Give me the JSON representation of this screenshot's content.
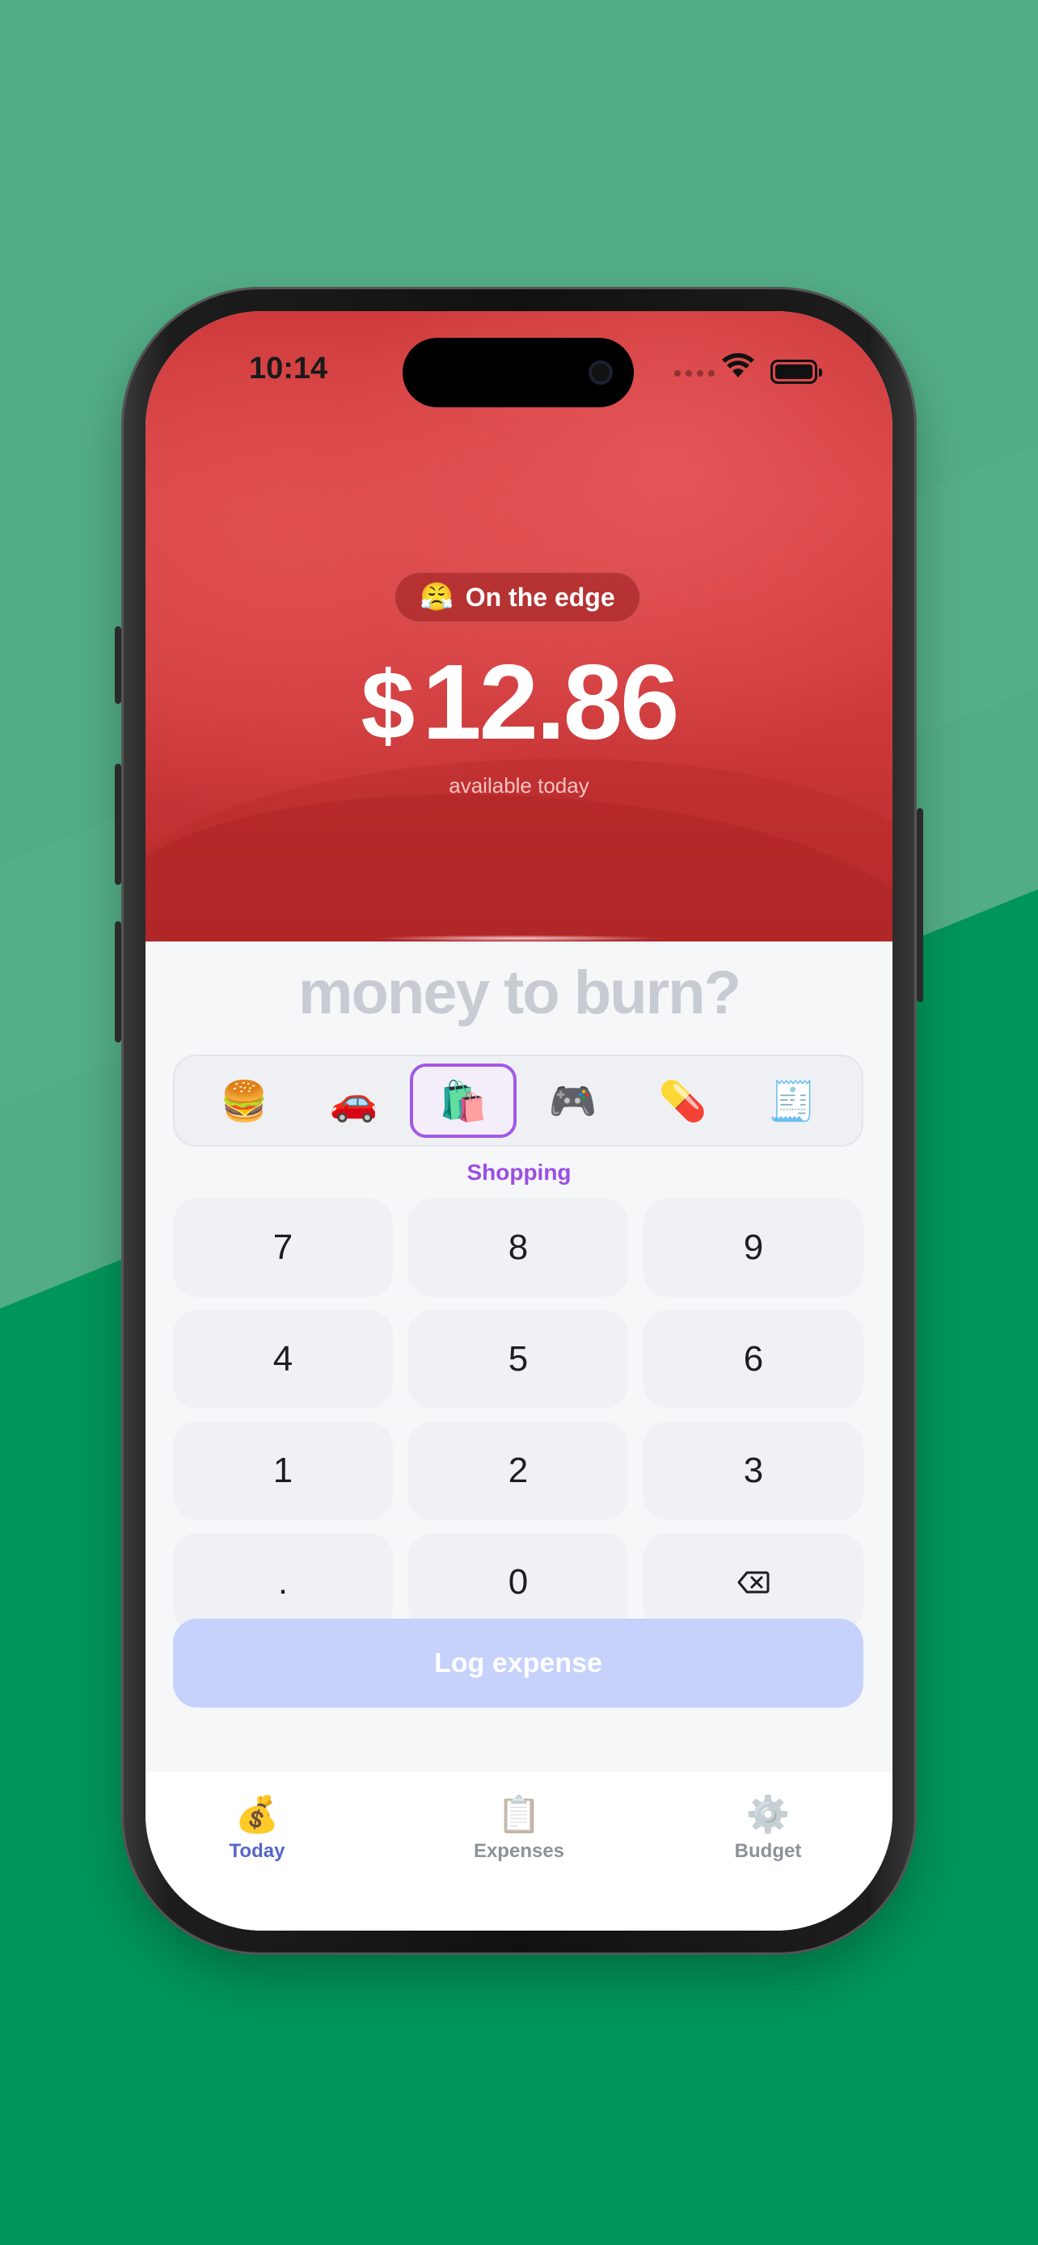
{
  "status_bar": {
    "time": "10:14"
  },
  "header": {
    "mood_emoji": "😤",
    "mood_label": "On the edge",
    "currency": "$",
    "amount": "12.86",
    "subtitle": "available today"
  },
  "prompt": "money to burn?",
  "categories": [
    {
      "icon": "🍔",
      "name": "burger-icon"
    },
    {
      "icon": "🚗",
      "name": "car-icon"
    },
    {
      "icon": "🛍️",
      "name": "shopping-bags-icon"
    },
    {
      "icon": "🎮",
      "name": "game-controller-icon"
    },
    {
      "icon": "💊",
      "name": "pill-icon"
    },
    {
      "icon": "🧾",
      "name": "receipt-icon"
    }
  ],
  "selected_category": "Shopping",
  "keypad": [
    "7",
    "8",
    "9",
    "4",
    "5",
    "6",
    "1",
    "2",
    "3",
    ".",
    "0",
    "⌫"
  ],
  "log_button": "Log expense",
  "tabs": [
    {
      "icon": "💰",
      "label": "Today",
      "active": true
    },
    {
      "icon": "📋",
      "label": "Expenses",
      "active": false
    },
    {
      "icon": "⚙️",
      "label": "Budget",
      "active": false
    }
  ],
  "colors": {
    "background": "#00965a",
    "header_red": "#d23d3f",
    "accent_purple": "#9b4fe0",
    "tab_active": "#5565c8",
    "log_button": "#c6d2fb"
  }
}
